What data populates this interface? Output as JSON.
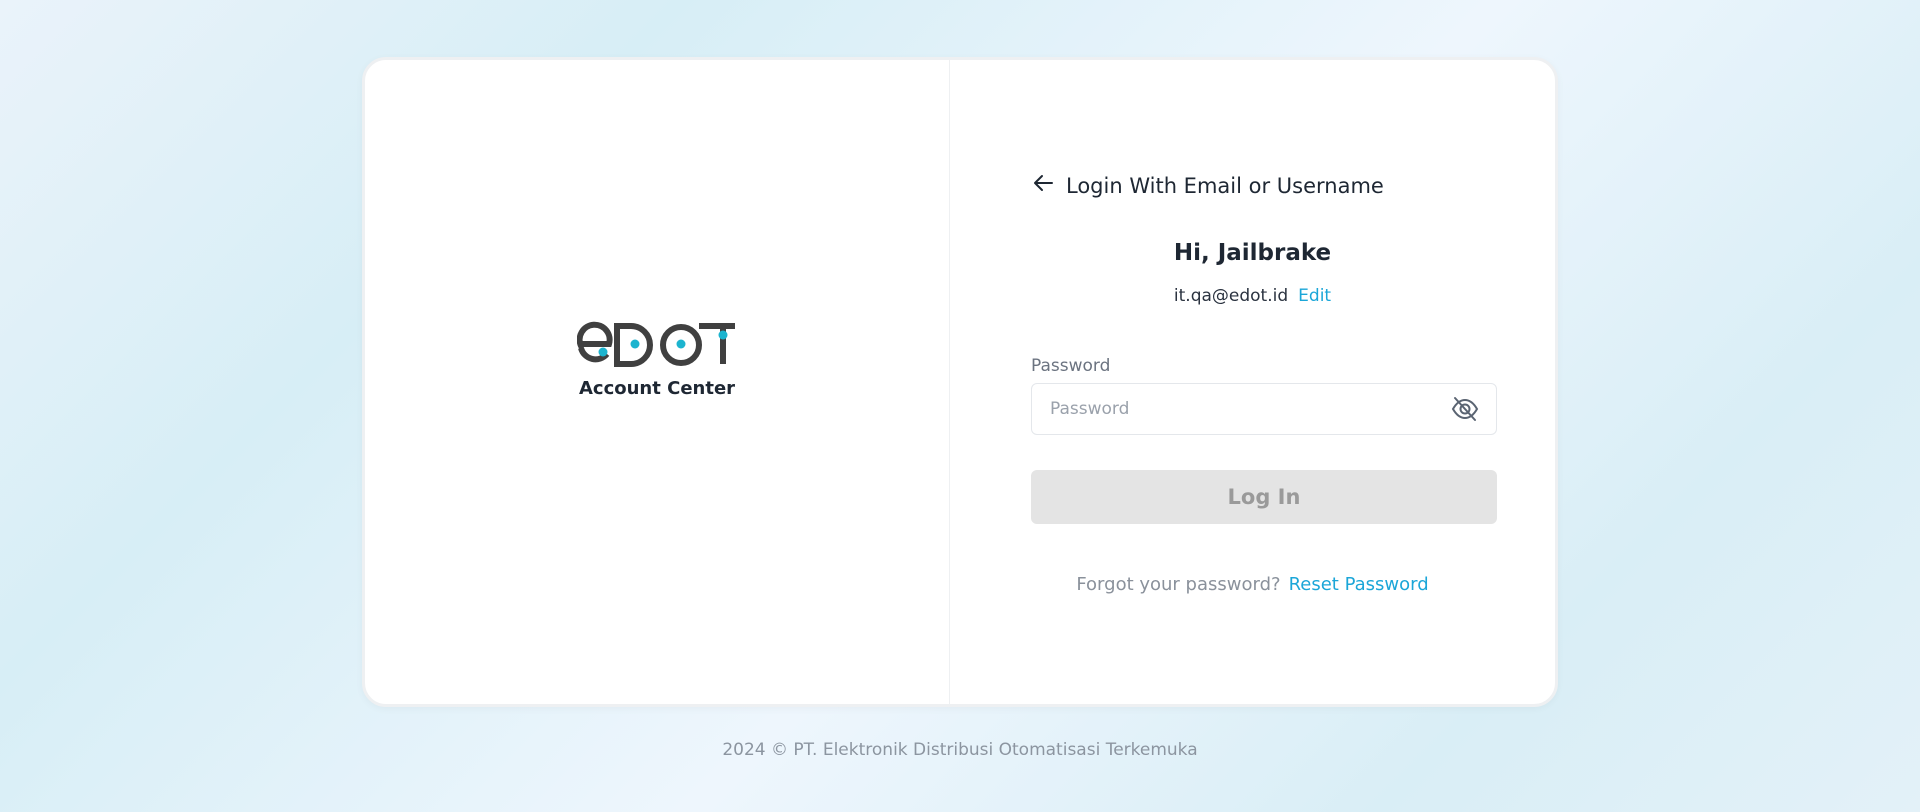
{
  "brand": {
    "logo_text": "eDOT",
    "subtitle": "Account Center",
    "primary_color": "#404040",
    "accent_color": "#1cb4cf"
  },
  "login": {
    "back_label": "Login With Email or Username",
    "greeting": "Hi, Jailbrake",
    "email": "it.qa@edot.id",
    "edit_label": "Edit",
    "password_label": "Password",
    "password_placeholder": "Password",
    "password_value": "",
    "submit_label": "Log In",
    "forgot_text": "Forgot your password?",
    "reset_label": "Reset Password",
    "link_color": "#1ba6d8"
  },
  "icons": {
    "back": "arrow-left-icon",
    "password_toggle": "eye-off-icon"
  },
  "footer": {
    "text": "2024 © PT. Elektronik Distribusi Otomatisasi Terkemuka"
  }
}
